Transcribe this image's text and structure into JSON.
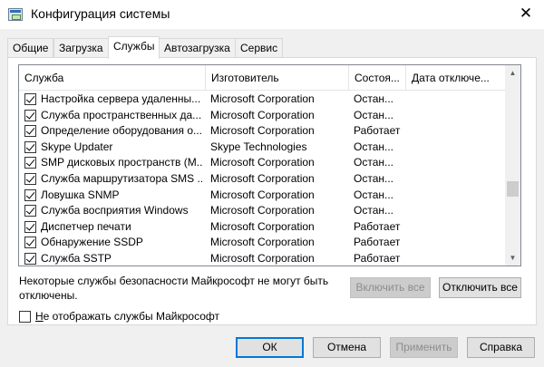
{
  "window": {
    "title": "Конфигурация системы",
    "close_glyph": "✕"
  },
  "tabs": [
    {
      "label": "Общие"
    },
    {
      "label": "Загрузка"
    },
    {
      "label": "Службы",
      "active": true
    },
    {
      "label": "Автозагрузка"
    },
    {
      "label": "Сервис"
    }
  ],
  "services": {
    "columns": [
      "Служба",
      "Изготовитель",
      "Состоя...",
      "Дата отключе..."
    ],
    "rows": [
      {
        "name": "Настройка сервера удаленны...",
        "manufacturer": "Microsoft Corporation",
        "status": "Остан...",
        "checked": true
      },
      {
        "name": "Служба пространственных да...",
        "manufacturer": "Microsoft Corporation",
        "status": "Остан...",
        "checked": true
      },
      {
        "name": "Определение оборудования о...",
        "manufacturer": "Microsoft Corporation",
        "status": "Работает",
        "checked": true
      },
      {
        "name": "Skype Updater",
        "manufacturer": "Skype Technologies",
        "status": "Остан...",
        "checked": true
      },
      {
        "name": "SMP дисковых пространств (M...",
        "manufacturer": "Microsoft Corporation",
        "status": "Остан...",
        "checked": true
      },
      {
        "name": "Служба маршрутизатора SMS ...",
        "manufacturer": "Microsoft Corporation",
        "status": "Остан...",
        "checked": true
      },
      {
        "name": "Ловушка SNMP",
        "manufacturer": "Microsoft Corporation",
        "status": "Остан...",
        "checked": true
      },
      {
        "name": "Служба восприятия Windows",
        "manufacturer": "Microsoft Corporation",
        "status": "Остан...",
        "checked": true
      },
      {
        "name": "Диспетчер печати",
        "manufacturer": "Microsoft Corporation",
        "status": "Работает",
        "checked": true
      },
      {
        "name": "Обнаружение SSDP",
        "manufacturer": "Microsoft Corporation",
        "status": "Работает",
        "checked": true
      },
      {
        "name": "Служба SSTP",
        "manufacturer": "Microsoft Corporation",
        "status": "Работает",
        "checked": true
      }
    ]
  },
  "note": "Некоторые службы безопасности Майкрософт не могут быть отключены.",
  "buttons": {
    "enable_all": "Включить все",
    "disable_all": "Отключить все",
    "ok": "ОК",
    "cancel": "Отмена",
    "apply": "Применить",
    "help": "Справка"
  },
  "hide_ms": {
    "label_first_letter": "Н",
    "label_rest": "е отображать службы Майкрософт",
    "checked": false
  },
  "colors": {
    "accent": "#0078d7",
    "window_bg": "#f0f0f0"
  }
}
